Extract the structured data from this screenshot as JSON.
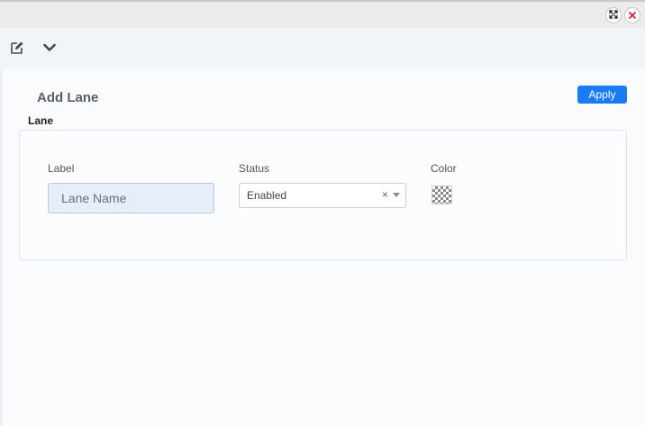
{
  "window": {
    "expand_icon": "expand-arrows-icon",
    "close_icon": "close-x-icon"
  },
  "toolbar": {
    "edit_icon": "edit-icon",
    "chevron_icon": "chevron-down-icon"
  },
  "panel": {
    "title": "Add Lane",
    "apply_label": "Apply",
    "section_label": "Lane",
    "fields": {
      "label": {
        "label": "Label",
        "placeholder": "Lane Name",
        "value": ""
      },
      "status": {
        "label": "Status",
        "selected": "Enabled",
        "clear_glyph": "×"
      },
      "color": {
        "label": "Color",
        "value": "transparent"
      }
    }
  },
  "colors": {
    "accent": "#1a7cf5",
    "close": "#e0102c",
    "title_text": "#5b5f63"
  }
}
